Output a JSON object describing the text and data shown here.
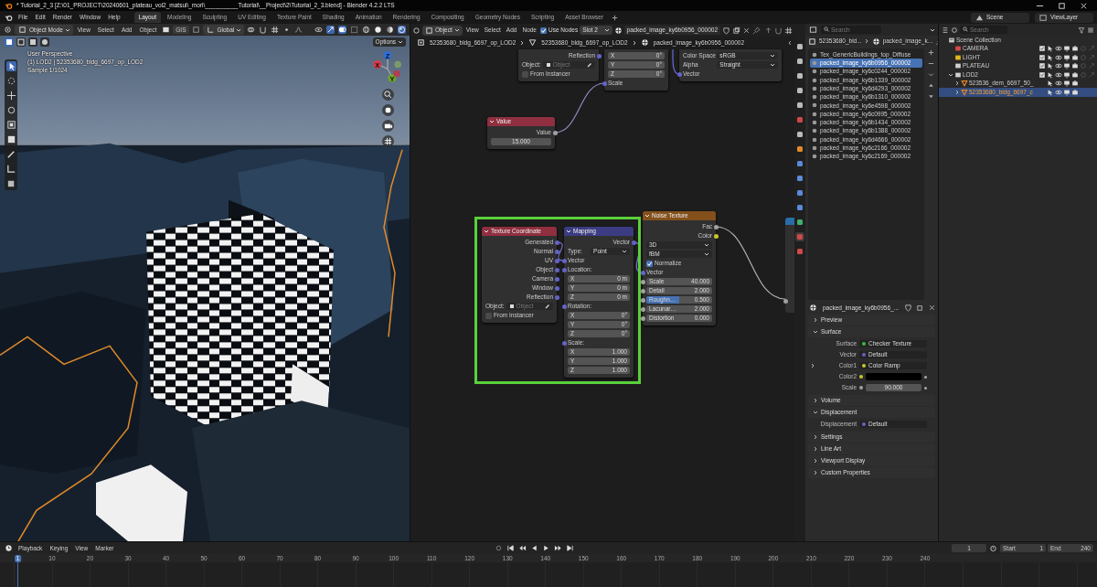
{
  "window": {
    "title": "* Tutorial_2_3 [Z:\\01_PROJECT\\20240601_plateau_vol2_matsui\\_mori\\__________Tutorial\\__Project\\2\\Tutorial_2_3.blend] - Blender 4.2.2 LTS"
  },
  "menu": [
    "File",
    "Edit",
    "Render",
    "Window",
    "Help"
  ],
  "workspaces": [
    {
      "label": "Layout",
      "selected": true
    },
    {
      "label": "Modeling",
      "selected": false
    },
    {
      "label": "Sculpting",
      "selected": false
    },
    {
      "label": "UV Editing",
      "selected": false
    },
    {
      "label": "Texture Paint",
      "selected": false
    },
    {
      "label": "Shading",
      "selected": false
    },
    {
      "label": "Animation",
      "selected": false
    },
    {
      "label": "Rendering",
      "selected": false
    },
    {
      "label": "Compositing",
      "selected": false
    },
    {
      "label": "Geometry Nodes",
      "selected": false
    },
    {
      "label": "Scripting",
      "selected": false
    },
    {
      "label": "Asset Browser",
      "selected": false
    }
  ],
  "scene": {
    "scene": "Scene",
    "view_layer": "ViewLayer"
  },
  "viewport": {
    "mode": "Object Mode",
    "menu": [
      "View",
      "Select",
      "Add",
      "Object"
    ],
    "gis": "GIS",
    "orientation": "Global",
    "options": "Options",
    "overlay": [
      "User Perspective",
      "(1) LOD2 | 52353680_bldg_6697_op_LOD2",
      "Sample 1/1024"
    ],
    "gizmo": [
      "Z",
      "X",
      "Y"
    ]
  },
  "node_editor": {
    "object": "Object",
    "menu": [
      "View",
      "Select",
      "Add",
      "Node"
    ],
    "use_nodes": {
      "label": "Use Nodes",
      "checked": true
    },
    "slot": "Slot 2",
    "image": "packed_image_ky6b0956_000002",
    "breadcrumb": [
      "52353680_bldg_6697_op_LOD2",
      "52353680_bldg_6697_op_LOD2",
      "packed_image_ky6b0956_000002"
    ],
    "nodes": [
      {
        "rows": [
          {
            "kind": "output",
            "label": "Reflection",
            "color": "#6363c7"
          },
          {
            "kind": "object",
            "label": "Object:",
            "placeholder": "Object"
          },
          {
            "kind": "checkbox",
            "label": "From Instancer",
            "checked": false
          }
        ]
      },
      {
        "rows": [
          {
            "kind": "field",
            "label": "X",
            "value": "0°"
          },
          {
            "kind": "field",
            "label": "Y",
            "value": "0°"
          },
          {
            "kind": "field",
            "label": "Z",
            "value": "0°"
          },
          {
            "kind": "input",
            "label": "Scale",
            "color": "#6363c7"
          }
        ]
      },
      {
        "rows": [
          {
            "kind": "select",
            "label": "Color Space",
            "value": "sRGB"
          },
          {
            "kind": "select",
            "label": "Alpha",
            "value": "Straight"
          },
          {
            "kind": "input",
            "label": "Vector",
            "color": "#6363c7"
          }
        ]
      },
      {
        "title": "Value",
        "color": "#8f2f3f",
        "rows": [
          {
            "kind": "output",
            "label": "Value",
            "color": "#a1a1a1"
          },
          {
            "kind": "field",
            "value": "15.000"
          }
        ]
      },
      {
        "title": "Texture Coordinate",
        "color": "#8f2f3f",
        "rows": [
          {
            "kind": "output",
            "label": "Generated",
            "color": "#6363c7"
          },
          {
            "kind": "output",
            "label": "Normal",
            "color": "#6363c7"
          },
          {
            "kind": "output",
            "label": "UV",
            "color": "#6363c7"
          },
          {
            "kind": "output",
            "label": "Object",
            "color": "#6363c7"
          },
          {
            "kind": "output",
            "label": "Camera",
            "color": "#6363c7"
          },
          {
            "kind": "output",
            "label": "Window",
            "color": "#6363c7"
          },
          {
            "kind": "output",
            "label": "Reflection",
            "color": "#6363c7"
          },
          {
            "kind": "object",
            "label": "Object:",
            "placeholder": "Object"
          },
          {
            "kind": "checkbox",
            "label": "From Instancer",
            "checked": false
          }
        ]
      },
      {
        "title": "Mapping",
        "color": "#3c3c83",
        "rows": [
          {
            "kind": "output",
            "label": "Vector",
            "color": "#6363c7"
          },
          {
            "kind": "select",
            "label": "Type:",
            "value": "Point"
          },
          {
            "kind": "input",
            "label": "Vector",
            "color": "#6363c7"
          },
          {
            "kind": "input",
            "label": "Location:",
            "color": "#6363c7"
          },
          {
            "kind": "field",
            "label": "X",
            "value": "0 m"
          },
          {
            "kind": "field",
            "label": "Y",
            "value": "0 m"
          },
          {
            "kind": "field",
            "label": "Z",
            "value": "0 m"
          },
          {
            "kind": "input",
            "label": "Rotation:",
            "color": "#6363c7"
          },
          {
            "kind": "field",
            "label": "X",
            "value": "0°"
          },
          {
            "kind": "field",
            "label": "Y",
            "value": "0°"
          },
          {
            "kind": "field",
            "label": "Z",
            "value": "0°"
          },
          {
            "kind": "input",
            "label": "Scale:",
            "color": "#6363c7"
          },
          {
            "kind": "field",
            "label": "X",
            "value": "1.000"
          },
          {
            "kind": "field",
            "label": "Y",
            "value": "1.000"
          },
          {
            "kind": "field",
            "label": "Z",
            "value": "1.000"
          }
        ]
      },
      {
        "title": "Noise Texture",
        "color": "#83501a",
        "rows": [
          {
            "kind": "output",
            "label": "Fac",
            "color": "#a1a1a1"
          },
          {
            "kind": "output",
            "label": "Color",
            "color": "#c7c729"
          },
          {
            "kind": "select",
            "value": "3D"
          },
          {
            "kind": "select",
            "value": "fBM"
          },
          {
            "kind": "checkbox",
            "label": "Normalize",
            "checked": true
          },
          {
            "kind": "input",
            "label": "Vector",
            "color": "#6363c7"
          },
          {
            "kind": "field",
            "label": "Scale",
            "value": "40.000",
            "color": "#a1a1a1"
          },
          {
            "kind": "field",
            "label": "Detail",
            "value": "2.000",
            "color": "#a1a1a1"
          },
          {
            "kind": "slider",
            "label": "Roughn…",
            "value": "0.500",
            "color": "#a1a1a1",
            "level": 0.5
          },
          {
            "kind": "field",
            "label": "Lacunar…",
            "value": "2.000",
            "color": "#a1a1a1"
          },
          {
            "kind": "field",
            "label": "Distortion",
            "value": "0.000",
            "color": "#a1a1a1"
          }
        ]
      }
    ]
  },
  "properties": {
    "search": "Search",
    "breadcrumb": [
      "52353680_bld...",
      "packed_image_k..."
    ],
    "images": [
      {
        "name": "Tex_GenericBuildings_top_Diffuse",
        "selected": false
      },
      {
        "name": "packed_image_ky6b0956_000002",
        "selected": true
      },
      {
        "name": "packed_image_ky6c0244_000002",
        "selected": false
      },
      {
        "name": "packed_image_ky6b1339_000002",
        "selected": false
      },
      {
        "name": "packed_image_ky6d4293_000002",
        "selected": false
      },
      {
        "name": "packed_image_ky6b1310_000002",
        "selected": false
      },
      {
        "name": "packed_image_ky6e4598_000002",
        "selected": false
      },
      {
        "name": "packed_image_ky6c0995_000002",
        "selected": false
      },
      {
        "name": "packed_image_ky6b1434_000002",
        "selected": false
      },
      {
        "name": "packed_image_ky6b1388_000002",
        "selected": false
      },
      {
        "name": "packed_image_ky6d4666_000002",
        "selected": false
      },
      {
        "name": "packed_image_ky6c2166_000002",
        "selected": false
      },
      {
        "name": "packed_image_ky6c2169_000002",
        "selected": false
      }
    ],
    "material": "packed_image_ky6b0956_...",
    "sections": [
      {
        "title": "Preview",
        "expanded": false
      },
      {
        "title": "Surface",
        "expanded": true,
        "rows": [
          {
            "label": "Surface",
            "kind": "link",
            "value": "Checker Texture",
            "color": "#35c035",
            "expandable": false
          },
          {
            "label": "Vector",
            "kind": "link",
            "value": "Default",
            "color": "#6363c7",
            "expandable": false
          },
          {
            "label": "Color1",
            "kind": "link",
            "value": "Color Ramp",
            "color": "#c7c729",
            "expandable": true
          },
          {
            "label": "Color2",
            "kind": "swatch",
            "color": "#c7c729",
            "swatch": {
              "color": "#000000"
            },
            "expandable": false
          },
          {
            "label": "Scale",
            "kind": "number",
            "value": "90.000",
            "color": "#a1a1a1",
            "expandable": false
          }
        ]
      },
      {
        "title": "Volume",
        "expanded": false
      },
      {
        "title": "Displacement",
        "expanded": true,
        "rows": [
          {
            "label": "Displacement",
            "kind": "link",
            "value": "Default",
            "color": "#6363c7",
            "expandable": false
          }
        ]
      },
      {
        "title": "Settings",
        "expanded": false
      },
      {
        "title": "Line Art",
        "expanded": false
      },
      {
        "title": "Viewport Display",
        "expanded": false
      },
      {
        "title": "Custom Properties",
        "expanded": false
      }
    ]
  },
  "outliner": {
    "search": "Search",
    "tree": [
      {
        "label": "Scene Collection",
        "kind": "scene",
        "selected": false,
        "children": [
          {
            "label": "CAMERA",
            "kind": "collection",
            "color": "#d84848",
            "selected": false
          },
          {
            "label": "LIGHT",
            "kind": "collection",
            "color": "#e2b81c",
            "selected": false
          },
          {
            "label": "PLATEAU",
            "kind": "collection",
            "color": "#d0d0d0",
            "selected": false
          },
          {
            "label": "LOD2",
            "kind": "collection",
            "color": "#d0d0d0",
            "selected": false,
            "expanded": true,
            "children": [
              {
                "label": "523536_dem_6697_50_",
                "kind": "mesh",
                "selected": false,
                "expanded": false
              },
              {
                "label": "52353680_bldg_6697_c",
                "kind": "mesh",
                "selected": true,
                "expanded": false
              }
            ]
          }
        ]
      }
    ]
  },
  "timeline": {
    "menu": [
      "Playback",
      "Keying",
      "View",
      "Marker"
    ],
    "current": "1",
    "start_label": "Start",
    "start": "1",
    "end_label": "End",
    "end": "240",
    "ruler": [
      {
        "label": "1",
        "selected": true
      },
      {
        "label": "10",
        "selected": false
      },
      {
        "label": "20",
        "selected": false
      },
      {
        "label": "30",
        "selected": false
      },
      {
        "label": "40",
        "selected": false
      },
      {
        "label": "50",
        "selected": false
      },
      {
        "label": "60",
        "selected": false
      },
      {
        "label": "70",
        "selected": false
      },
      {
        "label": "80",
        "selected": false
      },
      {
        "label": "90",
        "selected": false
      },
      {
        "label": "100",
        "selected": false
      },
      {
        "label": "110",
        "selected": false
      },
      {
        "label": "120",
        "selected": false
      },
      {
        "label": "130",
        "selected": false
      },
      {
        "label": "140",
        "selected": false
      },
      {
        "label": "150",
        "selected": false
      },
      {
        "label": "160",
        "selected": false
      },
      {
        "label": "170",
        "selected": false
      },
      {
        "label": "180",
        "selected": false
      },
      {
        "label": "190",
        "selected": false
      },
      {
        "label": "200",
        "selected": false
      },
      {
        "label": "210",
        "selected": false
      },
      {
        "label": "220",
        "selected": false
      },
      {
        "label": "230",
        "selected": false
      },
      {
        "label": "240",
        "selected": false
      }
    ]
  }
}
